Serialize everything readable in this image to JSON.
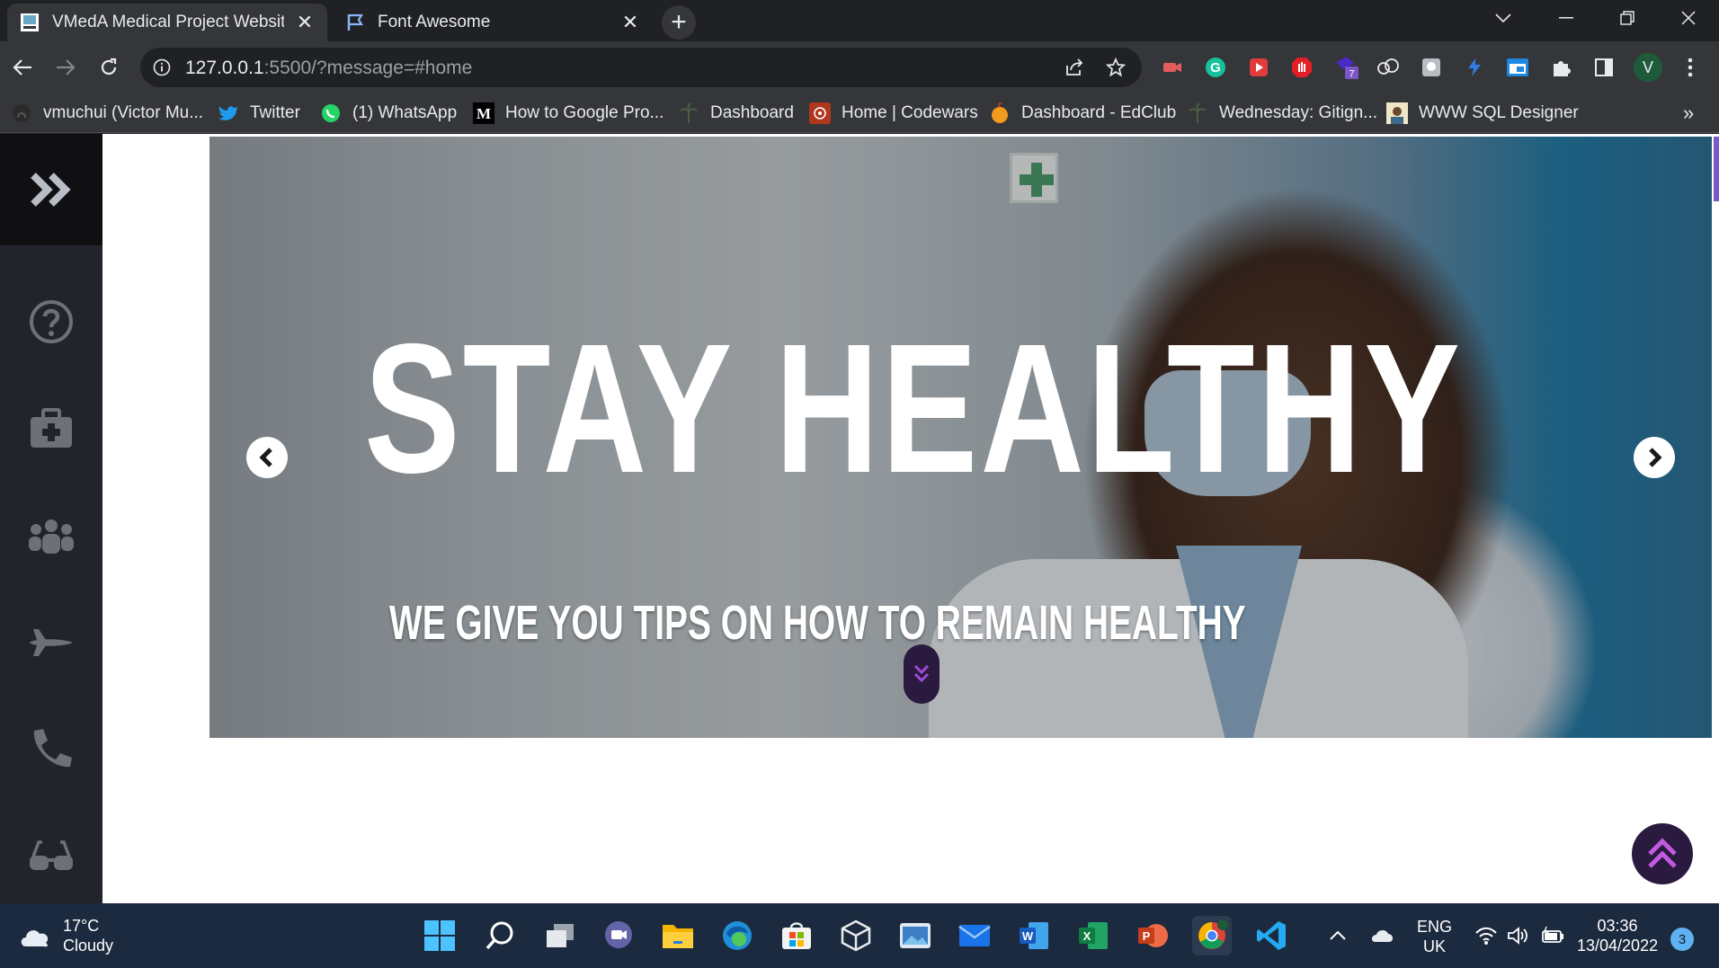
{
  "browser": {
    "tabs": [
      {
        "title": "VMedA Medical Project Website",
        "active": true
      },
      {
        "title": "Font Awesome",
        "active": false
      }
    ],
    "url_host": "127.0.0.1",
    "url_rest": ":5500/?message=#home",
    "bookmarks": [
      {
        "label": "vmuchui (Victor Mu...",
        "icon": "github-icon"
      },
      {
        "label": "Twitter",
        "icon": "twitter-icon"
      },
      {
        "label": "(1) WhatsApp",
        "icon": "whatsapp-icon"
      },
      {
        "label": "How to Google Pro...",
        "icon": "medium-icon"
      },
      {
        "label": "Dashboard",
        "icon": "palm-icon"
      },
      {
        "label": "Home | Codewars",
        "icon": "codewars-icon"
      },
      {
        "label": "Dashboard - EdClub",
        "icon": "edclub-icon"
      },
      {
        "label": "Wednesday: Gitign...",
        "icon": "palm-icon"
      },
      {
        "label": "WWW SQL Designer",
        "icon": "sql-icon"
      }
    ],
    "profile_initial": "V",
    "extension_badge": "7",
    "bookmarks_overflow": "»",
    "colors": {
      "tab_bg": "#202124",
      "toolbar_bg": "#35363a",
      "accent": "#7b57c8"
    }
  },
  "page": {
    "hero": {
      "headline": "STAY HEALTHY",
      "subline": "WE GIVE YOU TIPS ON HOW TO REMAIN HEALTHY"
    },
    "sidebar_icons": [
      "double-chevron-right-icon",
      "question-circle-icon",
      "medkit-icon",
      "users-icon",
      "plane-icon",
      "phone-icon",
      "glasses-icon"
    ]
  },
  "taskbar": {
    "weather_temp": "17°C",
    "weather_desc": "Cloudy",
    "lang_top": "ENG",
    "lang_bottom": "UK",
    "time": "03:36",
    "date": "13/04/2022",
    "notification_count": "3"
  }
}
